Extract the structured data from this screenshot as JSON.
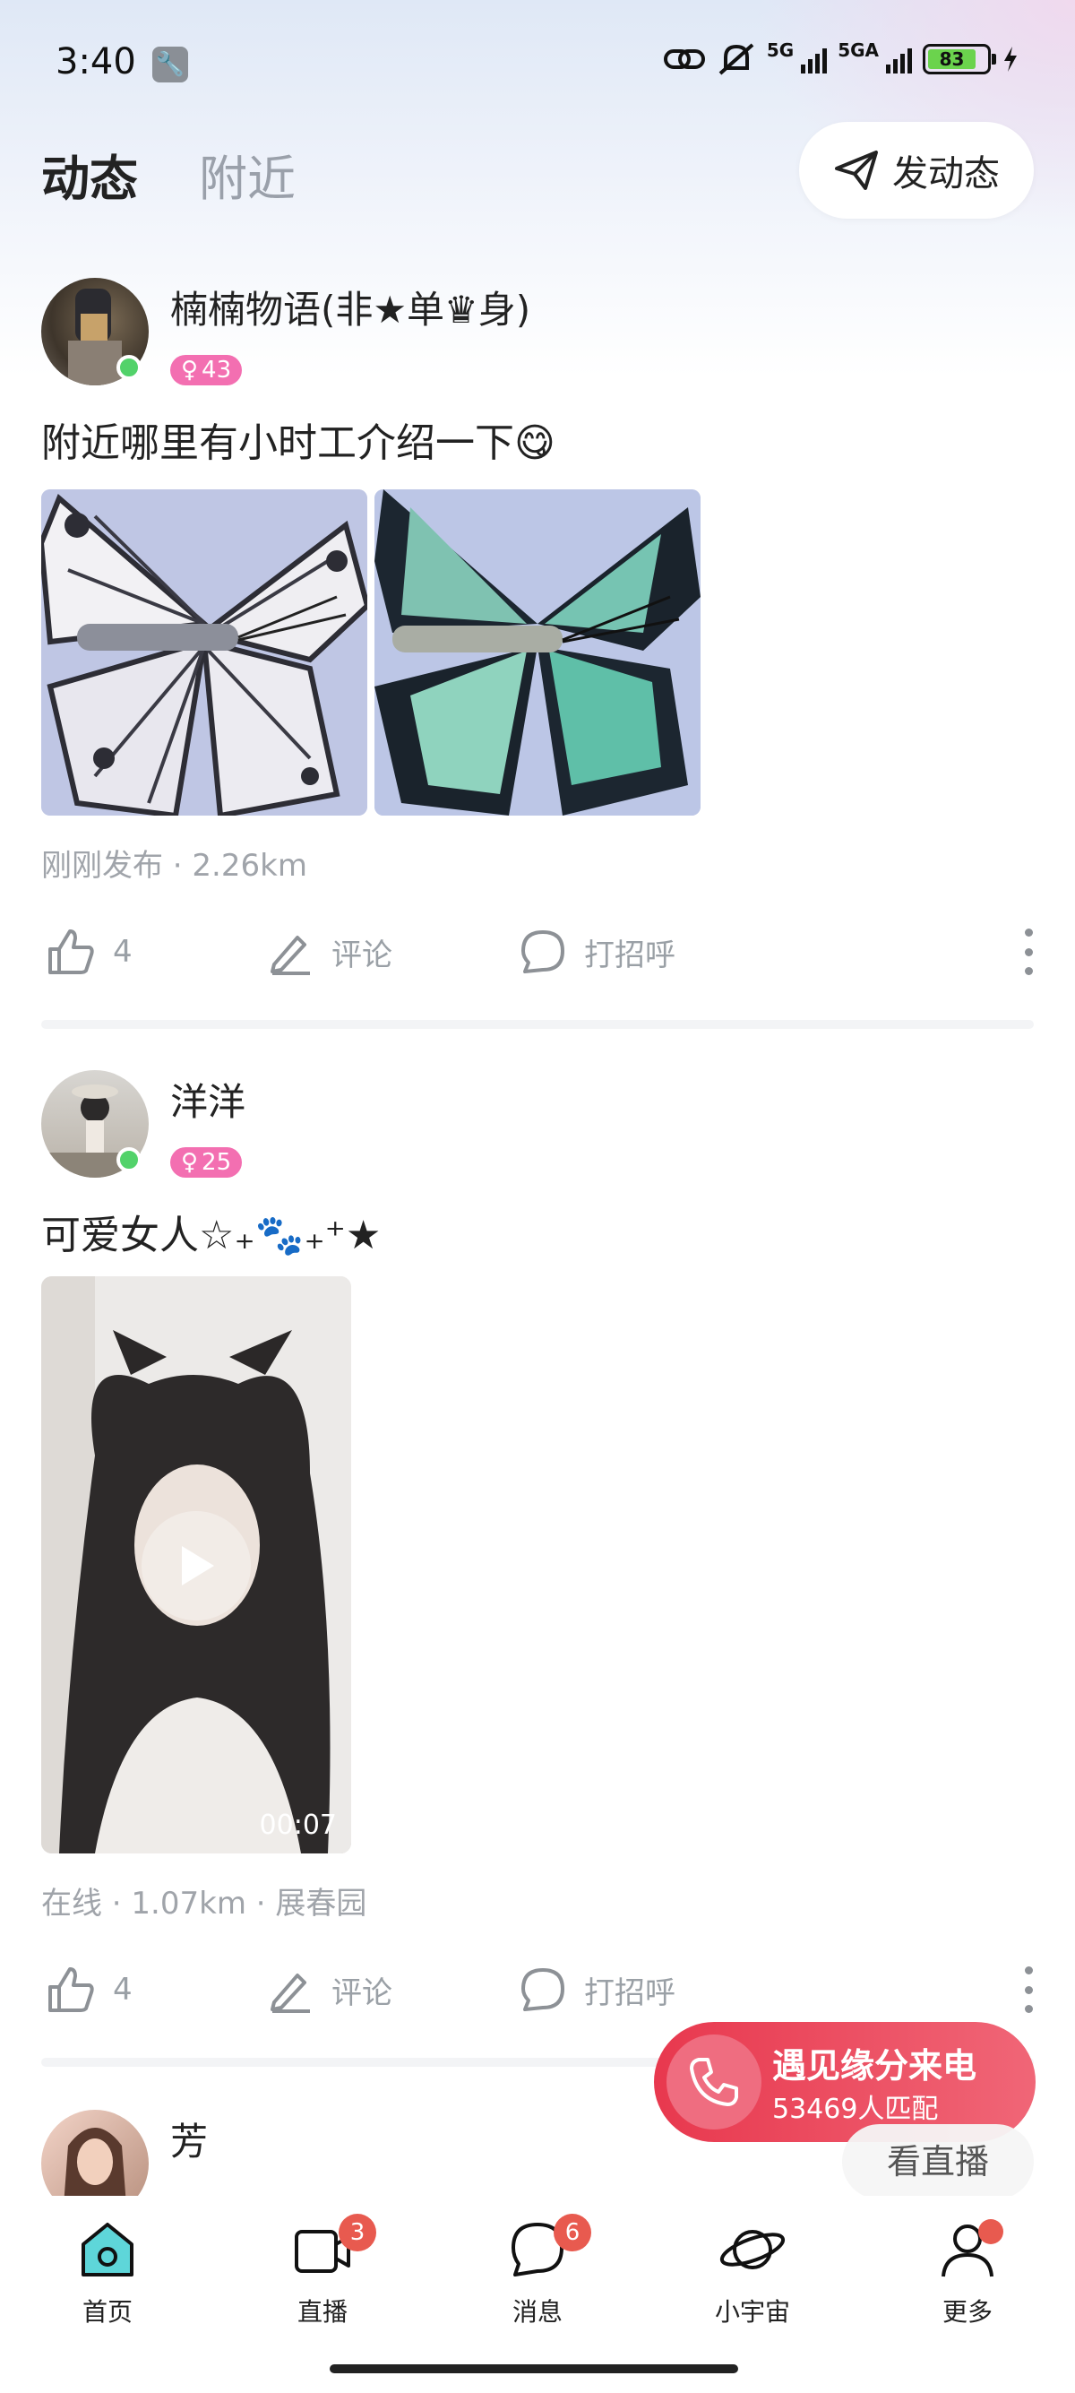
{
  "status_bar": {
    "time": "3:40",
    "network_1": "5G",
    "network_2": "5GA",
    "battery": "83"
  },
  "header": {
    "tabs": [
      {
        "label": "动态"
      },
      {
        "label": "附近"
      }
    ],
    "post_button_label": "发动态"
  },
  "posts": [
    {
      "username": "楠楠物语(非★单♛身)",
      "age": "43",
      "text": "附近哪里有小时工介绍一下",
      "emoji": "😋",
      "meta": "刚刚发布 · 2.26km",
      "likes": "4",
      "comment_label": "评论",
      "greet_label": "打招呼"
    },
    {
      "username": "洋洋",
      "age": "25",
      "text": "可爱女人☆₊🐾₊⁺★",
      "video_duration": "00:07",
      "meta": "在线 · 1.07km · 展春园",
      "likes": "4",
      "comment_label": "评论",
      "greet_label": "打招呼"
    },
    {
      "username": "芳"
    }
  ],
  "call_banner": {
    "title": "遇见缘分来电",
    "subtitle": "53469人匹配"
  },
  "live_pill": "看直播",
  "bottom_nav": [
    {
      "label": "首页"
    },
    {
      "label": "直播",
      "badge": "3"
    },
    {
      "label": "消息",
      "badge": "6"
    },
    {
      "label": "小宇宙"
    },
    {
      "label": "更多"
    }
  ],
  "colors": {
    "accent_pink": "#f36fb1",
    "banner_red": "#e8384e",
    "badge_red": "#e85a4f",
    "online_green": "#52d26a"
  }
}
